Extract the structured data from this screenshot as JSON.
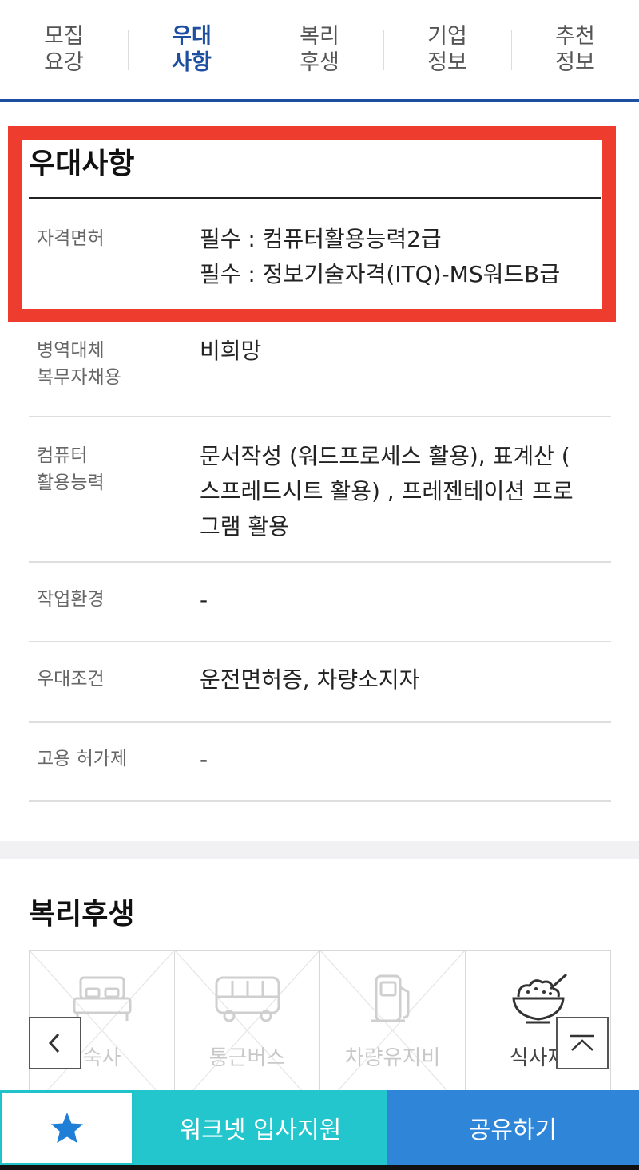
{
  "tabs": [
    {
      "line1": "모집",
      "line2": "요강"
    },
    {
      "line1": "우대",
      "line2": "사항"
    },
    {
      "line1": "복리",
      "line2": "후생"
    },
    {
      "line1": "기업",
      "line2": "정보"
    },
    {
      "line1": "추천",
      "line2": "정보"
    }
  ],
  "active_tab": "우대사항",
  "preference": {
    "title": "우대사항",
    "rows": [
      {
        "label": "자격면허",
        "value": "필수 : 컴퓨터활용능력2급\n필수 : 정보기술자격(ITQ)-MS워드B급"
      },
      {
        "label": "병역대체\n복무자채용",
        "value": "비희망"
      },
      {
        "label": "컴퓨터\n활용능력",
        "value": "문서작성 (워드프로세스 활용), 표계산 (\n스프레드시트 활용) , 프레젠테이션 프로\n그램 활용"
      },
      {
        "label": "작업환경",
        "value": "-"
      },
      {
        "label": "우대조건",
        "value": "운전면허증, 차량소지자"
      },
      {
        "label": "고용 허가제",
        "value": "-"
      }
    ]
  },
  "welfare": {
    "title": "복리후생",
    "items": [
      {
        "label": "기숙사",
        "visible_label": "숙사",
        "icon": "bed-icon",
        "enabled": false
      },
      {
        "label": "통근버스",
        "icon": "bus-icon",
        "enabled": false
      },
      {
        "label": "차량유지비",
        "icon": "fuel-pump-icon",
        "enabled": false
      },
      {
        "label": "식사제공",
        "visible_label": "식사제",
        "icon": "rice-bowl-icon",
        "enabled": true
      }
    ]
  },
  "bottom_bar": {
    "apply_label": "워크넷 입사지원",
    "share_label": "공유하기",
    "favorite_icon": "star-icon"
  },
  "colors": {
    "brand_blue": "#1e4ea0",
    "highlight_red": "#ee3c2e",
    "apply_teal": "#22c6cc",
    "share_blue": "#2f86d8",
    "star_blue": "#1f7ed6"
  }
}
